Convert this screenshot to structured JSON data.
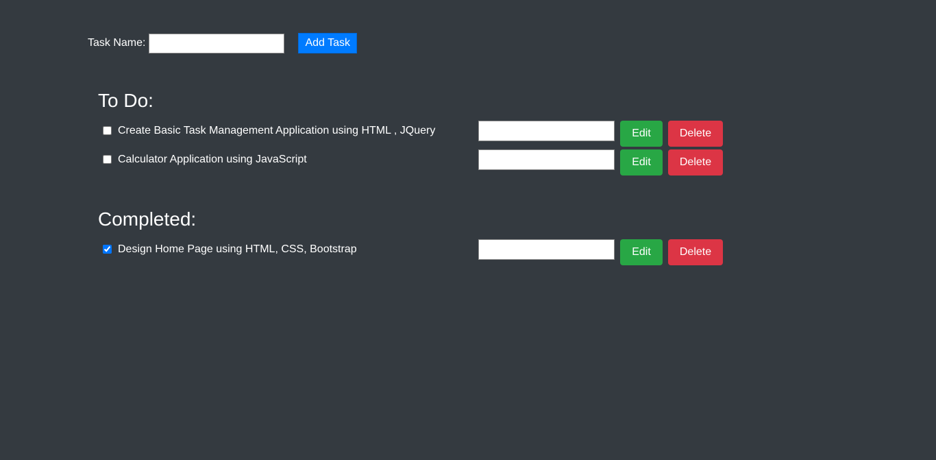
{
  "add_form": {
    "label": "Task Name:",
    "input_value": "",
    "button_label": "Add Task"
  },
  "todo": {
    "title": "To Do:",
    "tasks": [
      {
        "text": "Create Basic Task Management Application using HTML , JQuery",
        "checked": false,
        "edit_value": "",
        "edit_label": "Edit",
        "delete_label": "Delete"
      },
      {
        "text": "Calculator Application using JavaScript",
        "checked": false,
        "edit_value": "",
        "edit_label": "Edit",
        "delete_label": "Delete"
      }
    ]
  },
  "completed": {
    "title": "Completed:",
    "tasks": [
      {
        "text": "Design Home Page using HTML, CSS, Bootstrap",
        "checked": true,
        "edit_value": "",
        "edit_label": "Edit",
        "delete_label": "Delete"
      }
    ]
  },
  "colors": {
    "background": "#343a40",
    "primary": "#007bff",
    "success": "#28a745",
    "danger": "#dc3545"
  }
}
